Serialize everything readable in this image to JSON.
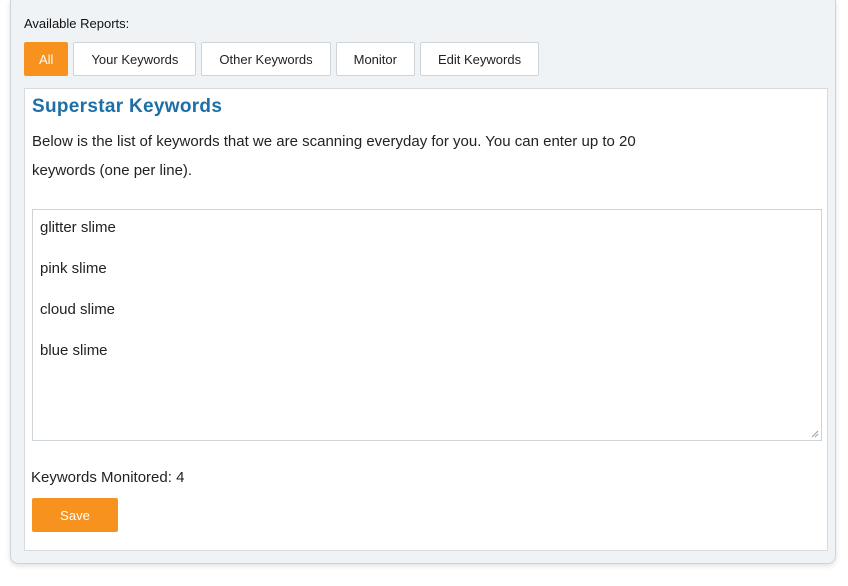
{
  "header": {
    "available_reports_label": "Available Reports:"
  },
  "tabs": [
    {
      "label": "All",
      "active": true
    },
    {
      "label": "Your Keywords",
      "active": false
    },
    {
      "label": "Other Keywords",
      "active": false
    },
    {
      "label": "Monitor",
      "active": false
    },
    {
      "label": "Edit Keywords",
      "active": false
    }
  ],
  "main": {
    "title": "Superstar Keywords",
    "description": "Below is the list of keywords that we are scanning everyday for you. You can enter up to 20 keywords (one per line).",
    "keywords": [
      "glitter slime",
      "pink slime",
      "cloud slime",
      "blue slime"
    ],
    "monitored_label": "Keywords Monitored: 4",
    "save_label": "Save"
  },
  "colors": {
    "accent": "#f7921e",
    "title": "#1d6fa5",
    "panel_bg": "#f0f3f6"
  }
}
